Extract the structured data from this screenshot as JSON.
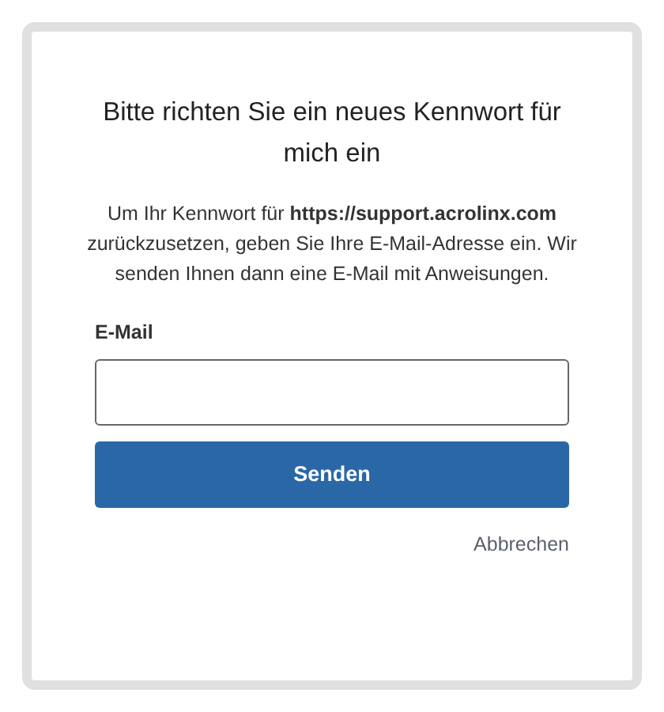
{
  "title": "Bitte richten Sie ein neues Kennwort für mich ein",
  "description": "Um Ihr Kennwort für **https://support.acrolinx.com** zurückzusetzen, geben Sie Ihre E-Mail-Adresse ein. Wir senden Ihnen dann eine E-Mail mit Anweisungen.",
  "email_field": {
    "label": "E-Mail"
  },
  "submit_button": "Senden",
  "cancel_link": "Abbrechen"
}
